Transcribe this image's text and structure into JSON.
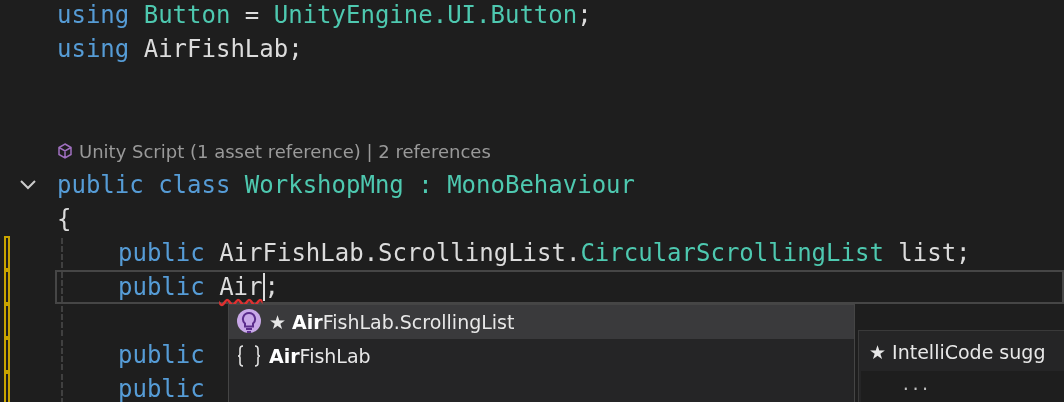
{
  "editor": {
    "lines": [
      {
        "kind": "code",
        "tokens": [
          {
            "kind": "keyword",
            "text": "using"
          },
          {
            "kind": "type",
            "text": "Button"
          },
          {
            "kind": "plain",
            "text": "="
          },
          {
            "kind": "type",
            "text": "UnityEngine.UI.Button"
          },
          {
            "kind": "punct",
            "text": ";"
          }
        ]
      },
      {
        "kind": "code",
        "tokens": [
          {
            "kind": "keyword",
            "text": "using"
          },
          {
            "kind": "plain",
            "text": "AirFishLab"
          },
          {
            "kind": "punct",
            "text": ";"
          }
        ]
      },
      {
        "kind": "blank"
      },
      {
        "kind": "blank"
      },
      {
        "kind": "codelens",
        "label": "Unity Script (1 asset reference)",
        "separator": "|",
        "references": "2 references"
      },
      {
        "kind": "code",
        "collapsible": true,
        "tokens": [
          {
            "kind": "keyword",
            "text": "public"
          },
          {
            "kind": "keyword",
            "text": "class"
          },
          {
            "kind": "type",
            "text": "WorkshopMng"
          },
          {
            "kind": "type",
            "text": ":"
          },
          {
            "kind": "type",
            "text": "MonoBehaviour"
          }
        ]
      },
      {
        "kind": "code",
        "tokens": [
          {
            "kind": "plain",
            "text": "{"
          }
        ]
      },
      {
        "kind": "member",
        "modified": true,
        "tokens": [
          {
            "kind": "keyword",
            "text": "public"
          },
          {
            "kind": "plain",
            "text": "AirFishLab"
          },
          {
            "kind": "dot",
            "text": "."
          },
          {
            "kind": "plain",
            "text": "ScrollingList"
          },
          {
            "kind": "dot",
            "text": "."
          },
          {
            "kind": "type",
            "text": "CircularScrollingList"
          },
          {
            "kind": "plain",
            "text": "list"
          },
          {
            "kind": "punct",
            "text": ";"
          }
        ]
      },
      {
        "kind": "member",
        "modified": true,
        "current": true,
        "tokens": [
          {
            "kind": "keyword",
            "text": "public"
          },
          {
            "kind": "error",
            "text": "Air",
            "cursor": true
          },
          {
            "kind": "punct",
            "text": ";"
          }
        ]
      },
      {
        "kind": "member",
        "modified": true
      },
      {
        "kind": "member",
        "modified": true,
        "tokens": [
          {
            "kind": "keyword",
            "text": "public"
          }
        ]
      },
      {
        "kind": "member",
        "modified": true,
        "tokens": [
          {
            "kind": "keyword",
            "text": "public"
          }
        ]
      }
    ]
  },
  "completion": {
    "items": [
      {
        "kind": "lightbulb",
        "selected": true,
        "label": "★ **Air**FishLab.ScrollingList"
      },
      {
        "kind": "namespace",
        "selected": false,
        "label": "**Air**FishLab"
      }
    ]
  },
  "tooltip": {
    "title": "★ IntelliCode sugg",
    "preview": "..."
  }
}
